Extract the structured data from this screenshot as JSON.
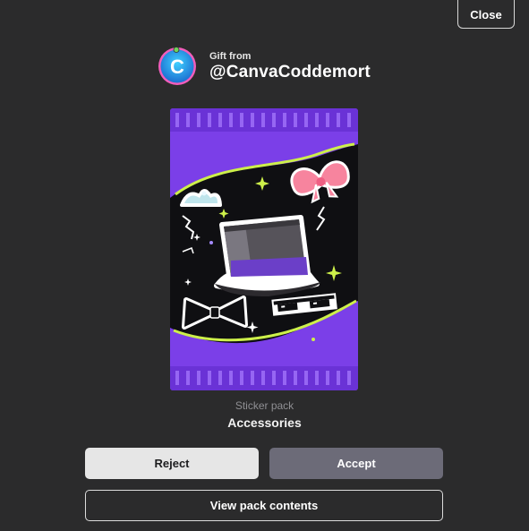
{
  "close_label": "Close",
  "sender": {
    "gift_label": "Gift from",
    "username": "@CanvaCoddemort",
    "avatar_letter": "C"
  },
  "pack": {
    "type_label": "Sticker pack",
    "name": "Accessories",
    "stickers": [
      "tiara-icon",
      "bow-icon",
      "top-hat-icon",
      "bow-tie-icon",
      "pixel-sunglasses-icon"
    ]
  },
  "actions": {
    "reject_label": "Reject",
    "accept_label": "Accept",
    "view_label": "View pack contents"
  },
  "colors": {
    "background": "#2b2b2c",
    "pack_purple": "#7b3fe8",
    "pack_black": "#0f0f12",
    "accent_lime": "#cdf04a",
    "accept_bg": "#6c6b78",
    "reject_bg": "#e6e6e6"
  }
}
